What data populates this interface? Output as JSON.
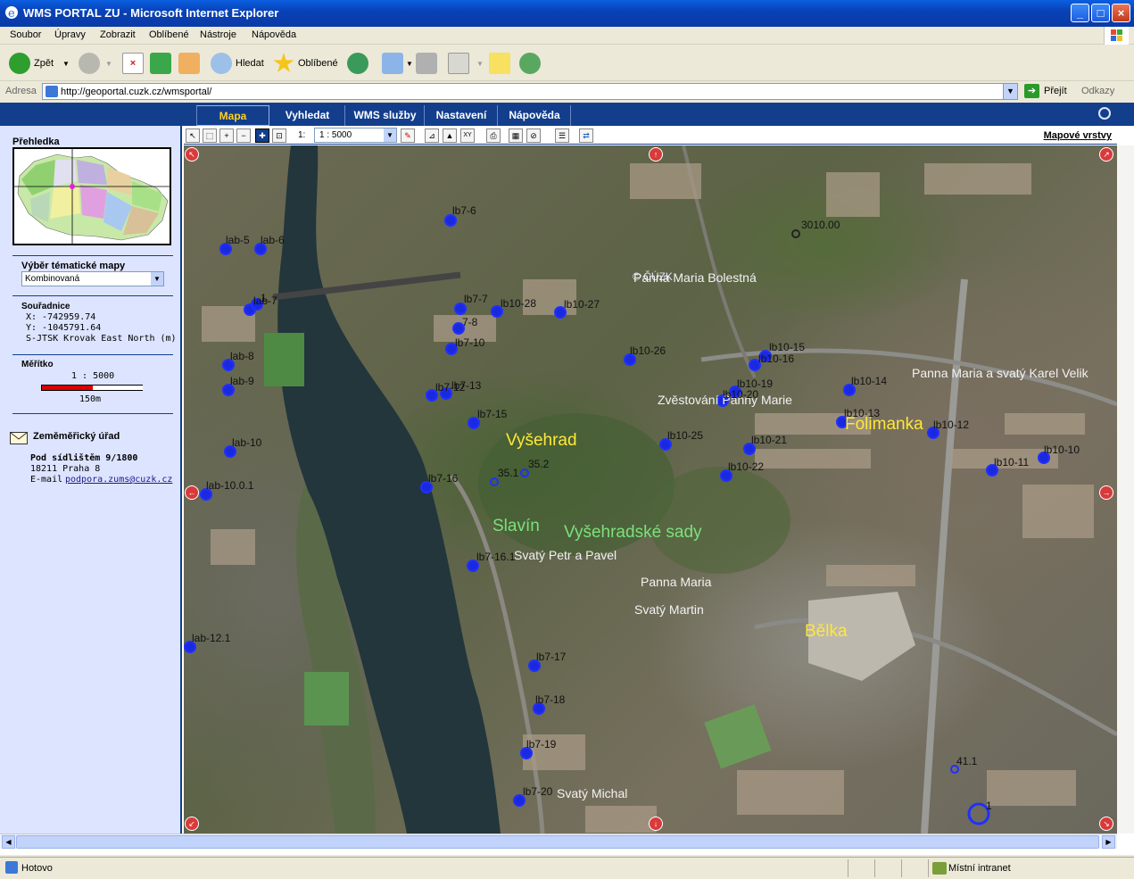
{
  "window": {
    "title": "WMS PORTAL ZU - Microsoft Internet Explorer"
  },
  "menu": [
    "Soubor",
    "Úpravy",
    "Zobrazit",
    "Oblíbené",
    "Nástroje",
    "Nápověda"
  ],
  "toolbar": {
    "back_label": "Zpět",
    "search_label": "Hledat",
    "favorites_label": "Oblíbené"
  },
  "address": {
    "label": "Adresa",
    "url": "http://geoportal.cuzk.cz/wmsportal/",
    "go_label": "Přejít",
    "links_label": "Odkazy"
  },
  "nav_tabs": [
    "Mapa",
    "Vyhledat",
    "WMS služby",
    "Nastavení",
    "Nápověda"
  ],
  "sidebar": {
    "overview_title": "Přehledka",
    "theme_title": "Výběr tématické mapy",
    "theme_value": "Kombinovaná",
    "coords_title": "Souřadnice",
    "x": "X: -742959.74",
    "y": "Y: -1045791.64",
    "crs": "S-JTSK Krovak East North (m)",
    "scale_title": "Měřítko",
    "scale_value": "1 : 5000",
    "scale_len": "150m",
    "org_name": "Zeměměřický úřad",
    "addr1": "Pod sídlištěm 9/1800",
    "addr2": "18211 Praha 8",
    "email_label": "E-mail",
    "email": "podpora.zums@cuzk.cz"
  },
  "map_toolbar": {
    "scale_prefix": "1:",
    "scale_value": "1 : 5000",
    "layers_link": "Mapové vrstvy"
  },
  "map": {
    "copyright": "© ČÚZK",
    "places_white": [
      {
        "name": "Panna Maria Bolestná"
      },
      {
        "name": "Zvěstování Panny Marie"
      },
      {
        "name": "Panna Maria a svatý Karel Velik"
      },
      {
        "name": "Svatý Petr a Pavel"
      },
      {
        "name": "Panna Maria"
      },
      {
        "name": "Svatý Martin"
      },
      {
        "name": "Svatý Michal"
      }
    ],
    "places_yellow": [
      "Vyšehrad",
      "Folimanka",
      "Bělka"
    ],
    "places_green": [
      "Slavín",
      "Vyšehradské sady"
    ],
    "points": [
      "lb7-6",
      "lab-5",
      "lab-6",
      "lab-7",
      "1",
      "lb7-7",
      "7-8",
      "lb7-10",
      "lb10-28",
      "lb10-27",
      "lab-8",
      "lab-9",
      "lb7-12",
      "lb7-13",
      "lb10-26",
      "lb10-15",
      "lb10-16",
      "lb10-19",
      "lb10-20",
      "lb10-14",
      "lb10-13",
      "lb10-12",
      "lb10-10",
      "lb10-11",
      "lab-10",
      "lb10-25",
      "lb10-21",
      "lb10-22",
      "lb7-15",
      "lab-10.0.1",
      "lb7-16",
      "lb7-16.1",
      "lab-12.1",
      "lb7-17",
      "lb7-18",
      "lb7-19",
      "lb7-20",
      "3010.00",
      "35.1",
      "35.2",
      "41.1",
      "1"
    ]
  },
  "status": {
    "text": "Hotovo",
    "zone": "Místní intranet"
  }
}
